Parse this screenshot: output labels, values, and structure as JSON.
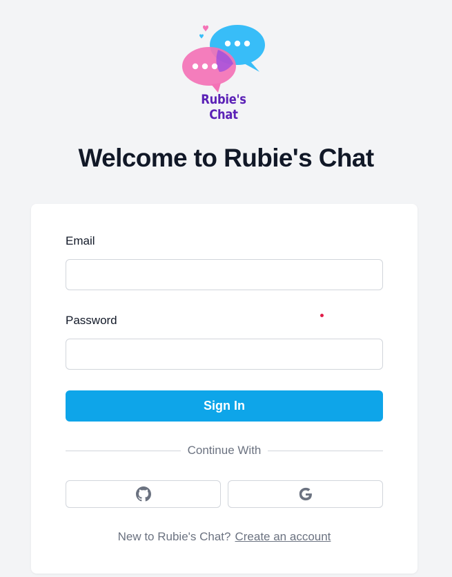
{
  "brand": {
    "logo_text": "Rubie's Chat",
    "colors": {
      "pink": "#f472b6",
      "blue": "#38bdf8",
      "purple": "#5b21b6"
    }
  },
  "page_title": "Welcome to Rubie's Chat",
  "form": {
    "email_label": "Email",
    "email_value": "",
    "password_label": "Password",
    "password_value": "",
    "submit_label": "Sign In",
    "accent": "#0ea5e9"
  },
  "divider_text": "Continue With",
  "social": [
    {
      "provider": "GitHub",
      "icon": "github-icon"
    },
    {
      "provider": "Google",
      "icon": "google-icon"
    }
  ],
  "footer": {
    "prompt": "New to Rubie's Chat?",
    "link_text": "Create an account"
  }
}
